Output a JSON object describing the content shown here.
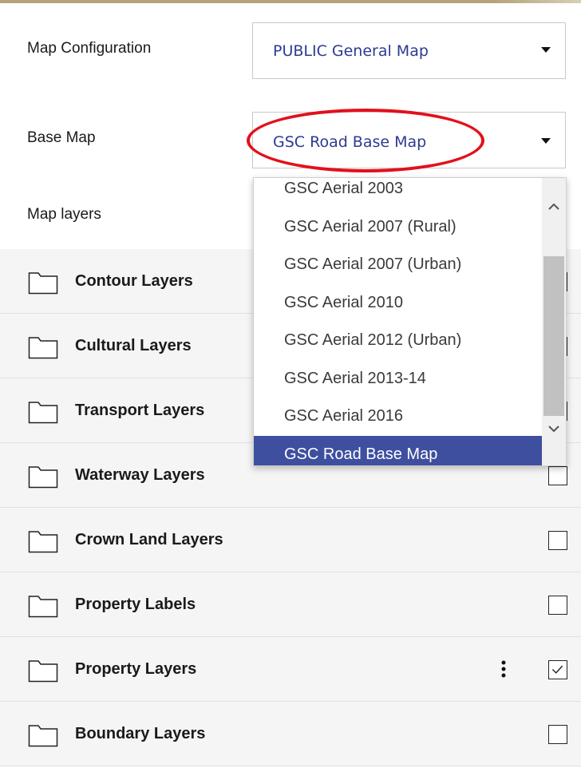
{
  "map_configuration": {
    "label": "Map Configuration",
    "selected": "PUBLIC General Map"
  },
  "base_map": {
    "label": "Base Map",
    "selected": "GSC Road Base Map",
    "options": [
      "GSC Aerial 2003",
      "GSC Aerial 2007 (Rural)",
      "GSC Aerial 2007 (Urban)",
      "GSC Aerial 2010",
      "GSC Aerial 2012 (Urban)",
      "GSC Aerial 2013-14",
      "GSC Aerial 2016",
      "GSC Road Base Map"
    ]
  },
  "map_layers": {
    "label": "Map layers",
    "layers": [
      {
        "name": "Contour Layers",
        "checked": false
      },
      {
        "name": "Cultural Layers",
        "checked": false
      },
      {
        "name": "Transport Layers",
        "checked": false
      },
      {
        "name": "Waterway Layers",
        "checked": false
      },
      {
        "name": "Crown Land Layers",
        "checked": false
      },
      {
        "name": "Property Labels",
        "checked": false
      },
      {
        "name": "Property Layers",
        "checked": true
      },
      {
        "name": "Boundary Layers",
        "checked": false
      }
    ]
  },
  "colors": {
    "select_text": "#2e3a91",
    "selected_option_bg": "#3f4f9f",
    "highlight": "#e3101a",
    "row_bg": "#f5f5f5"
  },
  "icons": {
    "folder": "folder-icon",
    "checkbox": "checkbox-icon",
    "kebab": "kebab-menu-icon",
    "caret": "caret-down-icon",
    "scroll_up": "chevron-up-icon",
    "scroll_down": "chevron-down-icon"
  }
}
